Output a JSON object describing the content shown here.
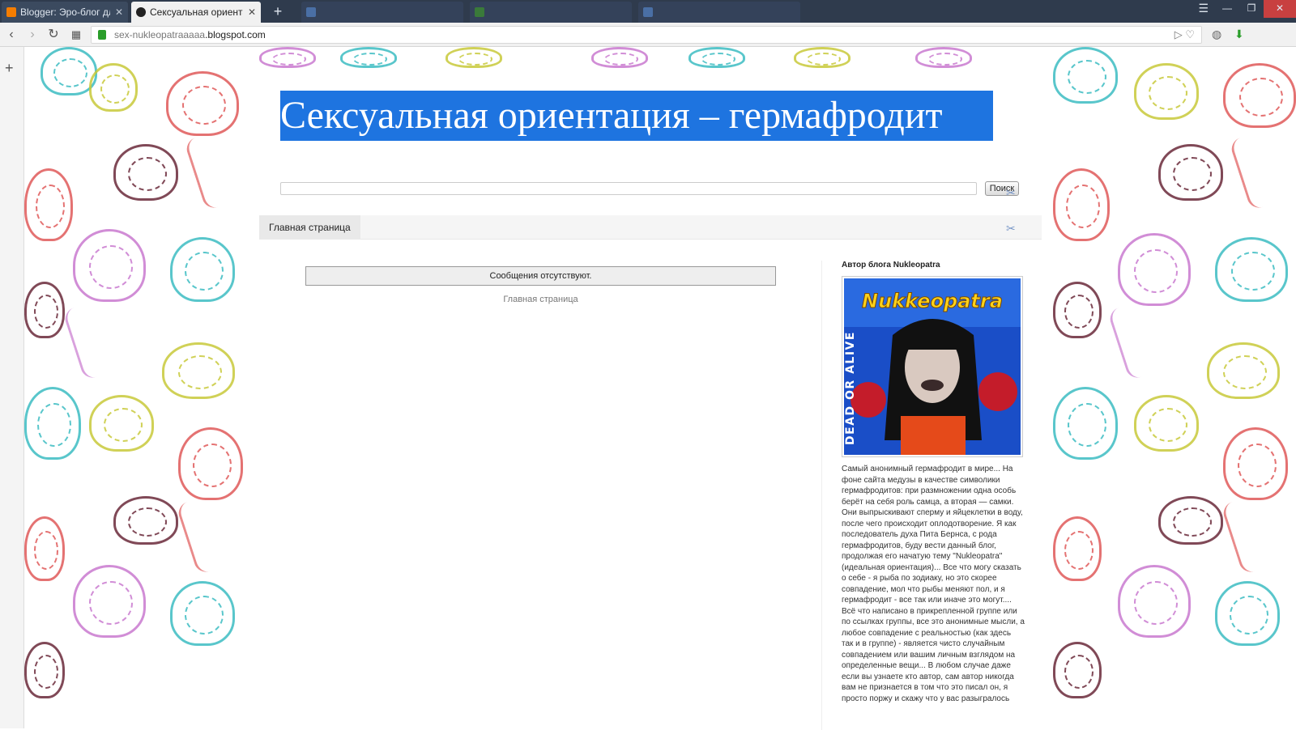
{
  "browser": {
    "tabs": [
      {
        "title": "Blogger: Эро-блог для уд",
        "active": false,
        "favicon_color": "#f57d00"
      },
      {
        "title": "Сексуальная ориентация",
        "active": true,
        "favicon_color": "#222222"
      }
    ],
    "url_path": "sex-nukleopatraaaaa",
    "url_host": ".blogspot.com"
  },
  "blog": {
    "title": "Сексуальная ориентация – гермафродит",
    "search_button": "Поиск",
    "nav_tab": "Главная страница",
    "no_posts": "Сообщения отсутствуют.",
    "home_link": "Главная страница",
    "sidebar": {
      "heading": "Автор блога Nukleopatra",
      "avatar_text": "Nukkeopatra",
      "avatar_side_text": "DEAD OR ALIVE",
      "description": "Самый анонимный гермафродит в мире... На фоне сайта медузы в качестве символики гермафродитов: при размножении одна особь берёт на себя роль самца, а вторая — самки. Они выпрыскивают сперму и яйцеклетки в воду, после чего происходит оплодотворение. Я как последователь духа Пита Бернса, с рода гермафродитов, буду вести данный блог, продолжая его начатую тему \"Nukleopatra\" (идеальная ориентация)... Все что могу сказать о себе - я рыба по зодиаку, но это скорее совпадение, мол что рыбы меняют пол, и я гермафродит - все так или иначе это могут.... Всё что написано в прикрепленной группе или по ссылках группы, все это анонимные мысли, а любое совпадение с реальностью (как здесь так и в группе) - является чисто случайным совпадением или вашим личным взглядом на определенные вещи... В любом случае даже если вы узнаете кто автор, сам автор никогда вам не признается в том что это писал он, я просто поржу и скажу что у вас разыгралось"
    }
  },
  "colors": {
    "selection": "#1e74e0",
    "jelly": [
      "#e05a5a",
      "#3dbdc2",
      "#c97ad0",
      "#c8c93a",
      "#6b2a3a"
    ]
  }
}
